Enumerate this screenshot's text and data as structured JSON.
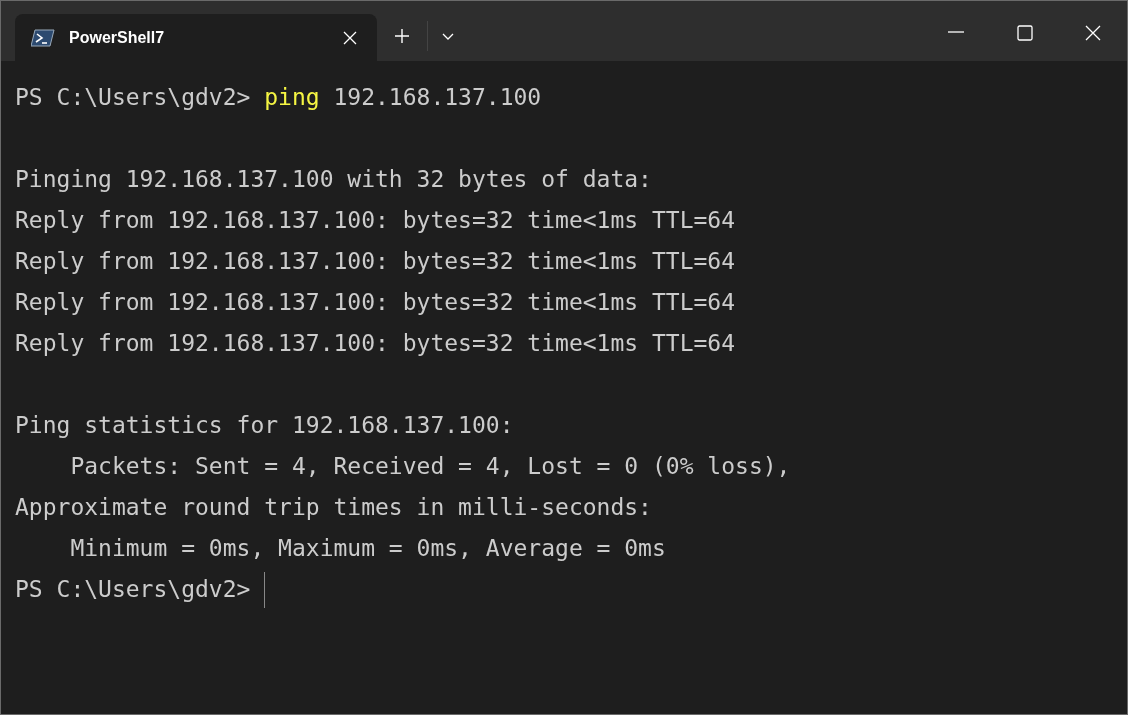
{
  "tabs": [
    {
      "title": "PowerShell7",
      "selected": true
    }
  ],
  "terminal": {
    "lines": [
      {
        "kind": "text",
        "segments": [
          {
            "kind": "prompt",
            "text": "PS C:\\Users\\gdv2>"
          },
          {
            "kind": "command",
            "text": "ping"
          },
          {
            "kind": "argument",
            "text": "192.168.137.100"
          }
        ]
      },
      {
        "kind": "blank"
      },
      {
        "kind": "text",
        "segments": [
          {
            "kind": "output",
            "text": "Pinging 192.168.137.100 with 32 bytes of data:"
          }
        ]
      },
      {
        "kind": "text",
        "segments": [
          {
            "kind": "output",
            "text": "Reply from 192.168.137.100: bytes=32 time<1ms TTL=64"
          }
        ]
      },
      {
        "kind": "text",
        "segments": [
          {
            "kind": "output",
            "text": "Reply from 192.168.137.100: bytes=32 time<1ms TTL=64"
          }
        ]
      },
      {
        "kind": "text",
        "segments": [
          {
            "kind": "output",
            "text": "Reply from 192.168.137.100: bytes=32 time<1ms TTL=64"
          }
        ]
      },
      {
        "kind": "text",
        "segments": [
          {
            "kind": "output",
            "text": "Reply from 192.168.137.100: bytes=32 time<1ms TTL=64"
          }
        ]
      },
      {
        "kind": "blank"
      },
      {
        "kind": "text",
        "segments": [
          {
            "kind": "output",
            "text": "Ping statistics for 192.168.137.100:"
          }
        ]
      },
      {
        "kind": "text",
        "segments": [
          {
            "kind": "output",
            "text": "    Packets: Sent = 4, Received = 4, Lost = 0 (0% loss),"
          }
        ]
      },
      {
        "kind": "text",
        "segments": [
          {
            "kind": "output",
            "text": "Approximate round trip times in milli-seconds:"
          }
        ]
      },
      {
        "kind": "text",
        "segments": [
          {
            "kind": "output",
            "text": "    Minimum = 0ms, Maximum = 0ms, Average = 0ms"
          }
        ]
      },
      {
        "kind": "text",
        "cursor": true,
        "segments": [
          {
            "kind": "prompt",
            "text": "PS C:\\Users\\gdv2>"
          }
        ]
      }
    ]
  }
}
